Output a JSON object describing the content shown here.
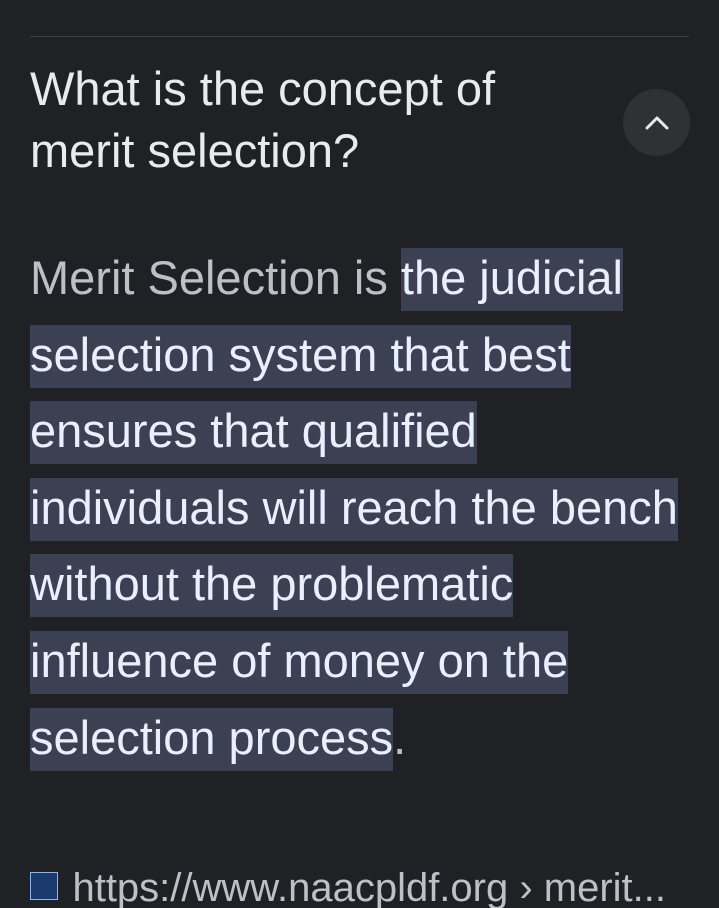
{
  "question": "What is the concept of merit selection?",
  "answer": {
    "lead_text": "Merit Selection is ",
    "highlighted_text": "the judicial selection system that best ensures that qualified individuals will reach the bench without the problematic influence of money on the selection process",
    "trailing_text": "."
  },
  "source": {
    "url_text": "https://www.naacpldf.org › merit..."
  },
  "icons": {
    "collapse": "chevron-up-icon",
    "favicon": "favicon-icon"
  },
  "colors": {
    "background": "#202124",
    "highlight": "#3b4152",
    "text": "#e8eaed"
  }
}
